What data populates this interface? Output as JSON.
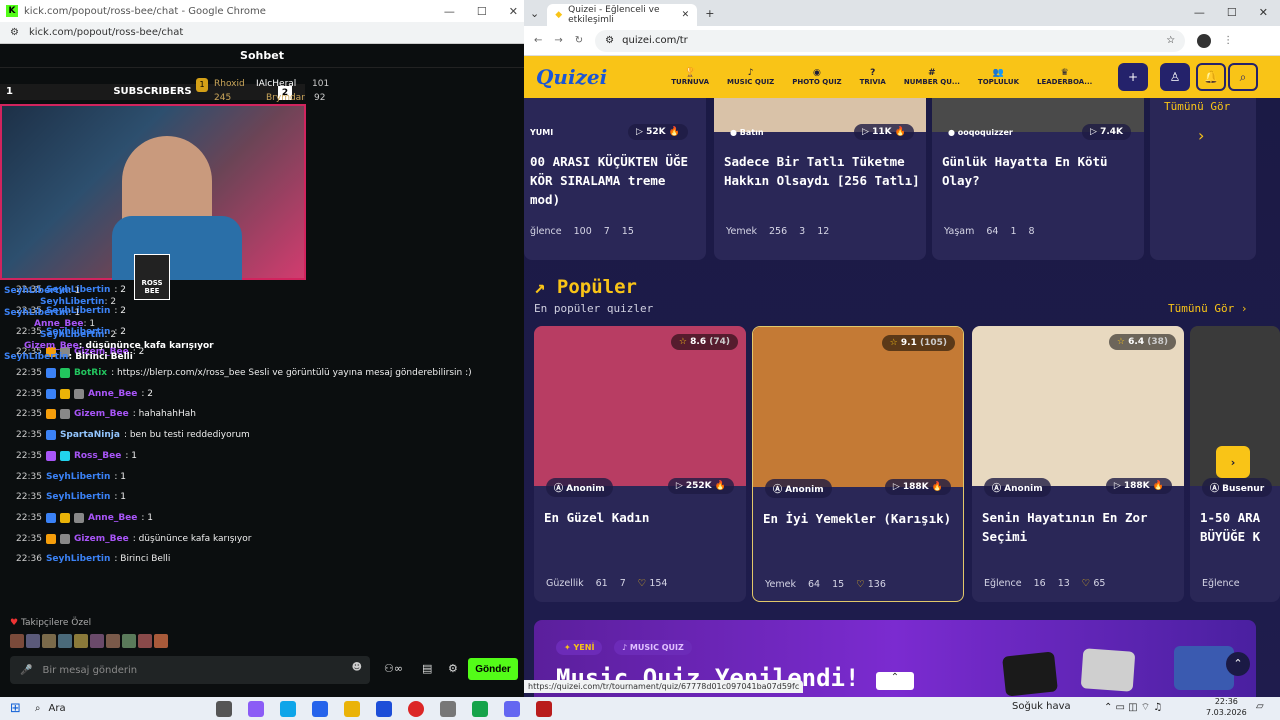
{
  "left_window": {
    "title": "kick.com/popout/ross-bee/chat - Google Chrome",
    "url": "kick.com/popout/ross-bee/chat",
    "chat_header": "Sohbet",
    "subscribers_label": "SUBSCRIBERS",
    "sub_rank": "1",
    "leaderboard": [
      {
        "name": "Rhoxid",
        "value": "245"
      },
      {
        "name": "IAlcHeral",
        "value": "101"
      },
      {
        "name": "Brymdar",
        "value": "92"
      }
    ],
    "leaderboard_rank": "2",
    "overlay_lines": [
      {
        "user": "SeyhLibertin",
        "text": ": 1"
      },
      {
        "user": "SeyhLibertin",
        "text": ": 2"
      },
      {
        "user": "SeyhLibertin",
        "text": ": 1"
      },
      {
        "user": "Anne_Bee",
        "text": ": 1"
      },
      {
        "user": "SeyhLibertin",
        "text": ": 2"
      },
      {
        "user": "Gizem_Bee",
        "text": ": düşününce kafa karışıyor"
      },
      {
        "user": "SeyhLibertin",
        "text": ": Birinci Belli"
      }
    ],
    "messages": [
      {
        "time": "22:35",
        "user": "SeyhLibertin",
        "color": "#3b82f6",
        "text": ": 2",
        "badges": []
      },
      {
        "time": "22:35",
        "user": "SeyhLibertin",
        "color": "#3b82f6",
        "text": ": 2",
        "badges": []
      },
      {
        "time": "22:35",
        "user": "SeyhLibertin",
        "color": "#3b82f6",
        "text": ": 2",
        "badges": []
      },
      {
        "time": "22:35",
        "user": "Gizem_Bee",
        "color": "#a855f7",
        "text": ": 2",
        "badges": [
          "#f59e0b",
          "#888888"
        ]
      },
      {
        "time": "22:35",
        "user": "BotRix",
        "color": "#22c55e",
        "text": ": https://blerp.com/x/ross_bee Sesli ve görüntülü yayına mesaj gönderebilirsin :)",
        "badges": [
          "#3b82f6",
          "#22c55e"
        ]
      },
      {
        "time": "22:35",
        "user": "Anne_Bee",
        "color": "#a855f7",
        "text": ": 2",
        "badges": [
          "#3b82f6",
          "#eab308",
          "#888888"
        ]
      },
      {
        "time": "22:35",
        "user": "Gizem_Bee",
        "color": "#a855f7",
        "text": ": hahahahHah",
        "badges": [
          "#f59e0b",
          "#888888"
        ]
      },
      {
        "time": "22:35",
        "user": "SpartaNinja",
        "color": "#93c5fd",
        "text": ": ben bu testi reddediyorum",
        "badges": [
          "#3b82f6"
        ]
      },
      {
        "time": "22:35",
        "user": "Ross_Bee",
        "color": "#a855f7",
        "text": ": 1",
        "badges": [
          "#a855f7",
          "#22d3ee"
        ]
      },
      {
        "time": "22:35",
        "user": "SeyhLibertin",
        "color": "#3b82f6",
        "text": ": 1",
        "badges": []
      },
      {
        "time": "22:35",
        "user": "SeyhLibertin",
        "color": "#3b82f6",
        "text": ": 1",
        "badges": []
      },
      {
        "time": "22:35",
        "user": "Anne_Bee",
        "color": "#a855f7",
        "text": ": 1",
        "badges": [
          "#3b82f6",
          "#eab308",
          "#888888"
        ]
      },
      {
        "time": "22:35",
        "user": "Gizem_Bee",
        "color": "#a855f7",
        "text": ": düşününce kafa karışıyor",
        "badges": [
          "#f59e0b",
          "#888888"
        ]
      },
      {
        "time": "22:36",
        "user": "SeyhLibertin",
        "color": "#3b82f6",
        "text": ": Birinci Belli",
        "badges": []
      }
    ],
    "followers_label": "Takipçilere Özel",
    "composer_placeholder": "Bir mesaj gönderin",
    "send_label": "Gönder"
  },
  "right_window": {
    "tab_title": "Quizei - Eğlenceli ve etkileşimli",
    "url": "quizei.com/tr",
    "logo": "Quizei",
    "nav": [
      {
        "icon": "trophy-icon",
        "glyph": "🏆",
        "label": "TURNUVA"
      },
      {
        "icon": "music-icon",
        "glyph": "♪",
        "label": "MUSIC QUIZ"
      },
      {
        "icon": "camera-icon",
        "glyph": "◉",
        "label": "PHOTO QUIZ"
      },
      {
        "icon": "question-icon",
        "glyph": "?",
        "label": "TRIVIA"
      },
      {
        "icon": "hash-icon",
        "glyph": "#",
        "label": "NUMBER QU..."
      },
      {
        "icon": "people-icon",
        "glyph": "👥",
        "label": "TOPLULUK"
      },
      {
        "icon": "crown-icon",
        "glyph": "♛",
        "label": "LEADERBOA..."
      }
    ],
    "top_see_all": "Tümünü Gör",
    "top_cards": [
      {
        "author": "YUMI",
        "plays": "52K",
        "title": "00 ARASI KÜÇÜKTEN ÜĞE KÖR SIRALAMA treme mod)",
        "category": "ğlence",
        "count": "100",
        "comments": "7",
        "likes": "15"
      },
      {
        "author": "Batın",
        "plays": "11K",
        "title": "Sadece Bir Tatlı Tüketme Hakkın Olsaydı [256 Tatlı]",
        "category": "Yemek",
        "count": "256",
        "comments": "3",
        "likes": "12"
      },
      {
        "author": "ooqoquizzer",
        "plays": "7.4K",
        "title": "Günlük Hayatta En Kötü Olay?",
        "category": "Yaşam",
        "count": "64",
        "comments": "1",
        "likes": "8"
      }
    ],
    "popular": {
      "heading": "Popüler",
      "subheading": "En popüler quizler",
      "see_all": "Tümünü Gör",
      "cards": [
        {
          "rating": "8.6",
          "votes": "(74)",
          "author": "Anonim",
          "plays": "252K",
          "title": "En Güzel Kadın",
          "category": "Güzellik",
          "count": "61",
          "comments": "7",
          "likes": "154",
          "img": "#b83d63"
        },
        {
          "rating": "9.1",
          "votes": "(105)",
          "author": "Anonim",
          "plays": "188K",
          "title": "En İyi Yemekler (Karışık)",
          "category": "Yemek",
          "count": "64",
          "comments": "15",
          "likes": "136",
          "img": "#c47a35"
        },
        {
          "rating": "6.4",
          "votes": "(38)",
          "author": "Anonim",
          "plays": "188K",
          "title": "Senin Hayatının En Zor Seçimi",
          "category": "Eğlence",
          "count": "16",
          "comments": "13",
          "likes": "65",
          "img": "#e8d9c0"
        },
        {
          "rating": "",
          "votes": "",
          "author": "Busenur",
          "plays": "",
          "title": "1-50 ARA BÜYÜĞE K",
          "category": "Eğlence",
          "count": "",
          "comments": "",
          "likes": "",
          "img": "#3a3a3a"
        }
      ]
    },
    "banner": {
      "tag1": "YENİ",
      "tag2": "MUSIC QUIZ",
      "title": "Music Quiz Yenilendi!"
    },
    "status_url": "https://quizei.com/tr/tournament/quiz/67778d01c097041ba07d59fc"
  },
  "taskbar": {
    "search": "Ara",
    "weather": "Soğuk hava",
    "time": "22:36",
    "date": "7.03.2026"
  }
}
